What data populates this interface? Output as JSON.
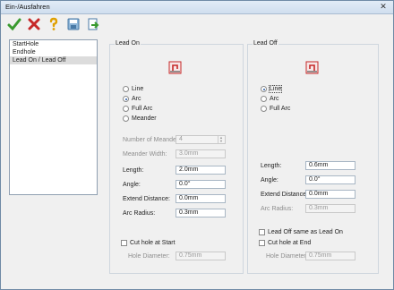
{
  "window": {
    "title": "Ein-/Ausfahren",
    "close_glyph": "✕"
  },
  "toolbar": {
    "buttons": [
      {
        "name": "ok-check-icon"
      },
      {
        "name": "cancel-x-icon"
      },
      {
        "name": "help-question-icon"
      },
      {
        "name": "save-icon"
      },
      {
        "name": "load-icon"
      }
    ]
  },
  "list": {
    "items": [
      "StartHole",
      "Endhole",
      "Lead On / Lead Off"
    ],
    "selected_index": 2
  },
  "lead_on": {
    "title": "Lead On",
    "icon": "lead-on-icon",
    "options": [
      "Line",
      "Arc",
      "Full Arc",
      "Meander"
    ],
    "selected": "Arc",
    "labels": {
      "meanders": "Number of Meanders:",
      "meander_width": "Meander Width:",
      "length": "Length:",
      "angle": "Angle:",
      "extend": "Extend Distance:",
      "arc_radius": "Arc Radius:",
      "cut_hole": "Cut hole at Start",
      "hole_diameter": "Hole Diameter:"
    },
    "values": {
      "meanders": "4",
      "meander_width": "3.0mm",
      "length": "2.0mm",
      "angle": "0.0°",
      "extend": "0.0mm",
      "arc_radius": "0.3mm",
      "hole_diameter": "0.75mm"
    }
  },
  "lead_off": {
    "title": "Lead Off",
    "icon": "lead-off-icon",
    "options": [
      "Line",
      "Arc",
      "Full Arc"
    ],
    "selected": "Line",
    "labels": {
      "length": "Length:",
      "angle": "Angle:",
      "extend": "Extend Distance:",
      "arc_radius": "Arc Radius:",
      "same_as_lead_on": "Lead Off same as Lead On",
      "cut_hole": "Cut hole at End",
      "hole_diameter": "Hole Diameter:"
    },
    "values": {
      "length": "0.6mm",
      "angle": "0.0°",
      "extend": "0.0mm",
      "arc_radius": "0.3mm",
      "hole_diameter": "0.75mm"
    }
  },
  "colors": {
    "accent": "#2b5ea8",
    "icon_red": "#c62828",
    "check_green": "#3a9a2f"
  }
}
